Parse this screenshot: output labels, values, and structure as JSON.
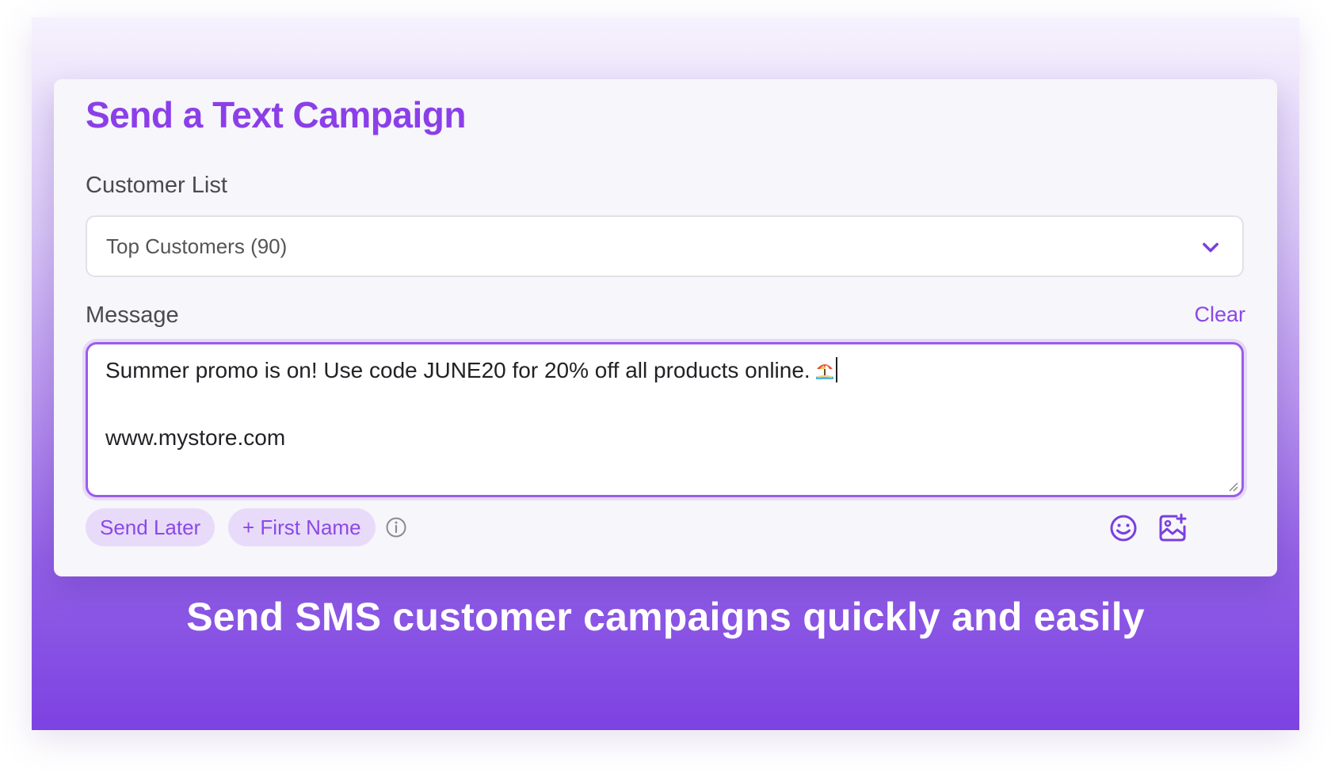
{
  "card": {
    "title": "Send a Text Campaign",
    "customer_list": {
      "label": "Customer List",
      "selected": "Top Customers (90)"
    },
    "message": {
      "label": "Message",
      "clear_label": "Clear",
      "line1": "Summer promo is on! Use code JUNE20 for 20% off all products online.",
      "line2": "www.mystore.com",
      "emoji_icon_name": "beach-umbrella-emoji"
    },
    "actions": {
      "send_later": "Send Later",
      "first_name": "+ First Name"
    }
  },
  "caption": "Send SMS customer campaigns quickly and easily",
  "colors": {
    "accent": "#8b3fe8",
    "chip_bg": "#e8dbfa",
    "banner_bottom": "#7d42e2"
  }
}
